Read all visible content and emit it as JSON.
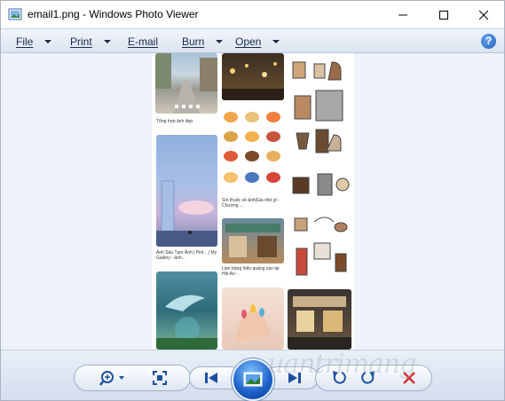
{
  "window": {
    "title": "email1.png - Windows Photo Viewer"
  },
  "menu": {
    "items": [
      {
        "label": "File"
      },
      {
        "label": "Print"
      },
      {
        "label": "E-mail"
      },
      {
        "label": "Burn"
      },
      {
        "label": "Open"
      }
    ],
    "help_label": "?"
  },
  "photo": {
    "captions": {
      "street": "Tổng hợp ảnh đẹp",
      "anime_sky": "Ảnh Sáu Tạm Ảnh | Pinl... | My Gallery - ảnh...",
      "food": "Sìn thuộc về ảnh|Gia nhó gì - Chương ...",
      "shop": "Làm bảng hiệu quảng cáo tại Hội An -"
    }
  },
  "toolbar": {
    "zoom_icon": "zoom-in-icon",
    "fit_icon": "actual-size-icon",
    "prev_icon": "previous-icon",
    "slideshow_icon": "slideshow-icon",
    "next_icon": "next-icon",
    "rotate_ccw_icon": "rotate-counterclockwise-icon",
    "rotate_cw_icon": "rotate-clockwise-icon",
    "delete_icon": "delete-icon"
  },
  "watermark": {
    "text": "uantrimang"
  },
  "colors": {
    "accent": "#1b5fc8",
    "menu_bg": "#dbe4f1",
    "viewer_bg": "#eef3fb",
    "delete_red": "#d32f2f"
  }
}
